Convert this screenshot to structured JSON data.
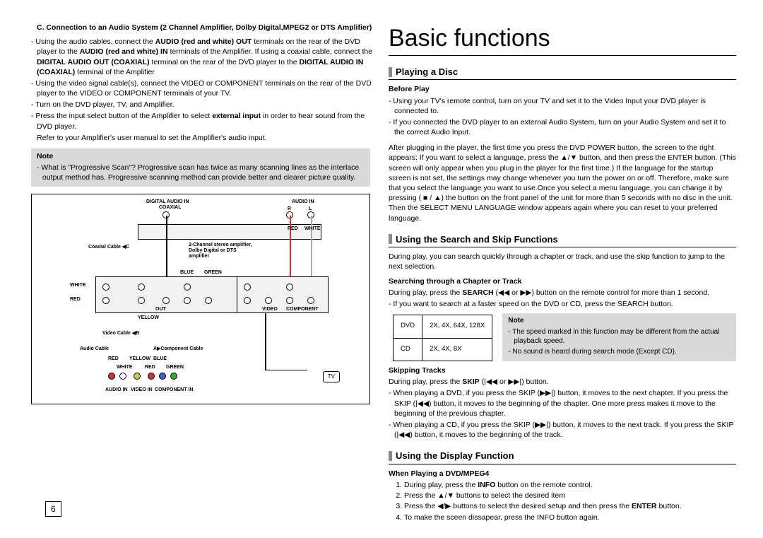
{
  "pageNumber": "6",
  "left": {
    "sectionC": "C. Connection to an Audio System (2 Channel Amplifier, Dolby Digital,MPEG2 or DTS Amplifier)",
    "para1_prefix": "- Using the audio cables, connect the ",
    "audio_out": "AUDIO (red and white) OUT",
    "para1_mid": " terminals on the rear of the DVD player to the ",
    "audio_in": "AUDIO (red and white) IN",
    "para1_mid2": " terminals of the Amplifier. If using a coaxial cable, connect the ",
    "dig_out": "DIGITAL AUDIO OUT (COAXIAL)",
    "para1_mid3": " terminal on the rear of the DVD player to the ",
    "dig_in": "DIGITAL AUDIO IN (COAXIAL)",
    "para1_end": " terminal of the Amplifier",
    "para2": "- Using the video signal cable(s), connect the VIDEO or COMPONENT terminals on the rear of the DVD player to the VIDEO or COMPONENT terminals of your TV.",
    "para3": "- Turn on the DVD player, TV, and Amplifier.",
    "para4_prefix": "- Press the input select button of the Amplifier to select ",
    "ext_input": "external input",
    "para4_end": "  in order to hear sound from the DVD player.",
    "para5": "Refer to your Amplifier's user manual to set the Amplifier's audio input.",
    "noteTitle": "Note",
    "noteBody": "- What is \"Progressive Scan\"? Progressive scan has twice as many scanning lines as the interlace output method has. Progressive scanning method can provide better and clearer picture quality.",
    "dg": {
      "dai": "DIGITAL AUDIO IN",
      "coax": "COAXIAL",
      "ai": "AUDIO IN",
      "r": "R",
      "l": "L",
      "red": "RED",
      "white": "WHITE",
      "yellow": "YELLOW",
      "blue": "BLUE",
      "green": "GREEN",
      "coaxcable": "Coaxial Cable",
      "amp": "2-Channel stereo amplifier, Dolby Digital or DTS amplifier",
      "videocable": "Video Cable",
      "audiocable": "Audio Cable",
      "compcable": "Component Cable",
      "out": "OUT",
      "video": "VIDEO",
      "component": "COMPONENT",
      "audioin": "AUDIO IN",
      "videoin": "VIDEO IN",
      "componentin": "COMPONENT IN",
      "tv": "TV",
      "tagA": "A",
      "tagB": "B",
      "tagC": "C"
    }
  },
  "right": {
    "mainTitle": "Basic functions",
    "sec1": "Playing a Disc",
    "beforePlay": "Before Play",
    "bp1": "- Using your TV's remote control, turn on your TV and set it to the Video Input your DVD player   is connected to.",
    "bp2": "- If you connected the DVD player to an external Audio System, turn on your Audio System and set it to the correct Audio Input.",
    "bpPara": "After plugging in the player, the first time you press the DVD POWER button, the screen to the right appears: If you want to select a language, press the ▲/▼ button, and then press the ENTER button. (This screen will only appear when you plug in the player for the first time.) If the language for the startup screen is not set, the settings may change whenever you turn the power on or off. Therefore, make sure that you select the language you want to use.Once you select a menu language, you can change it by pressing ( ■ / ▲) the button on the front panel of the unit for more than 5 seconds with no disc in the unit. Then the SELECT MENU LANGUAGE window appears again where you can reset to your preferred language.",
    "sec2": "Using the Search and Skip Functions",
    "sec2intro": "During play, you can search quickly through a chapter or track, and use the skip function to jump to the next selection.",
    "searchHead": "Searching through a Chapter or Track",
    "searchBody_pre": "During play, press the ",
    "searchBold": "SEARCH",
    "searchBody_post": " (◀◀ or ▶▶) button on the remote control for more than 1 second.",
    "searchBody2": "- If you want to search at a faster speed on the DVD or CD, press the SEARCH button.",
    "tbl": {
      "r1c1": "DVD",
      "r1c2": "2X, 4X, 64X, 128X",
      "r2c1": "CD",
      "r2c2": "2X, 4X, 8X"
    },
    "speedNoteTitle": "Note",
    "speedNote1": "- The speed marked in this function may be different from the actual playback speed.",
    "speedNote2": "- No sound is heard during search mode (Except CD).",
    "skipHead": "Skipping Tracks",
    "skip_pre": "During play, press the ",
    "skipBold": "SKIP",
    "skip_post": " (|◀◀ or ▶▶|) button.",
    "skip1": "- When playing a DVD, if you press the SKIP (▶▶|) button, it moves to the next chapter. If you press the SKIP (|◀◀) button, it moves to the beginning of the chapter. One more press makes it move to the beginning of the previous chapter.",
    "skip2": "- When playing a CD, if you press the SKIP (▶▶|) button, it  moves to the next track. If you press the SKIP (|◀◀) button, it moves to the beginning of the track.",
    "sec3": "Using the Display Function",
    "whenHead": "When Playing a DVD/MPEG4",
    "steps": [
      "During play, press the INFO button on the remote control.",
      "Press the  ▲/▼ buttons to select the desired item",
      "Press the  ◀/▶ buttons to select the desired setup and then press the ENTER button.",
      "To make the sceen dissapear, press the INFO button again."
    ],
    "step1_pre": "During play, press the ",
    "step1_bold": "INFO",
    "step1_post": " button on the remote control.",
    "step3_pre": "Press the  ◀/▶ buttons to select the desired setup and then press the ",
    "step3_bold": "ENTER",
    "step3_post": " button."
  }
}
